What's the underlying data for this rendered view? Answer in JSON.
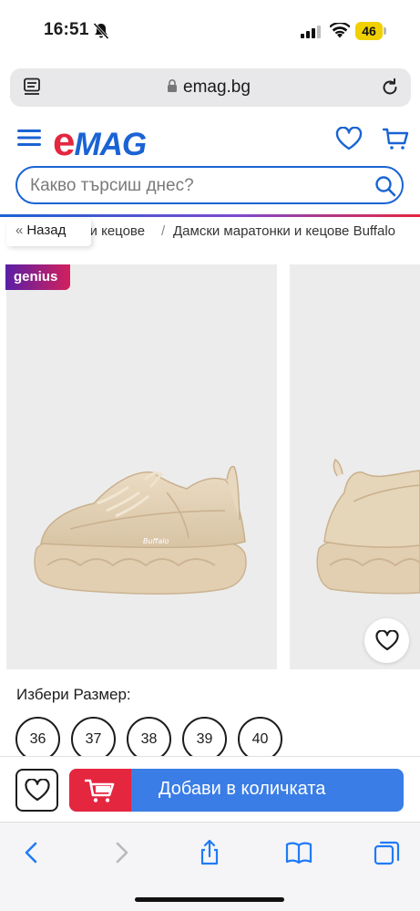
{
  "status_bar": {
    "time": "16:51",
    "battery": "46"
  },
  "browser": {
    "url": "emag.bg"
  },
  "header": {
    "logo_e": "e",
    "logo_rest": "MAG",
    "search_placeholder": "Какво търсиш днес?"
  },
  "breadcrumb": {
    "back_label": "Назад",
    "partial_crumb": "и и кецове",
    "separator": "/",
    "current": "Дамски маратонки и кецове Buffalo"
  },
  "gallery": {
    "badge": "genius"
  },
  "sizes": {
    "label": "Избери Размер:",
    "options": [
      "36",
      "37",
      "38",
      "39",
      "40"
    ]
  },
  "actions": {
    "add_to_cart": "Добави в количката"
  },
  "colors": {
    "brand_blue": "#1a63d4",
    "brand_red": "#e5263f",
    "button_blue": "#3a7de6",
    "ios_blue": "#1f7bf6"
  }
}
